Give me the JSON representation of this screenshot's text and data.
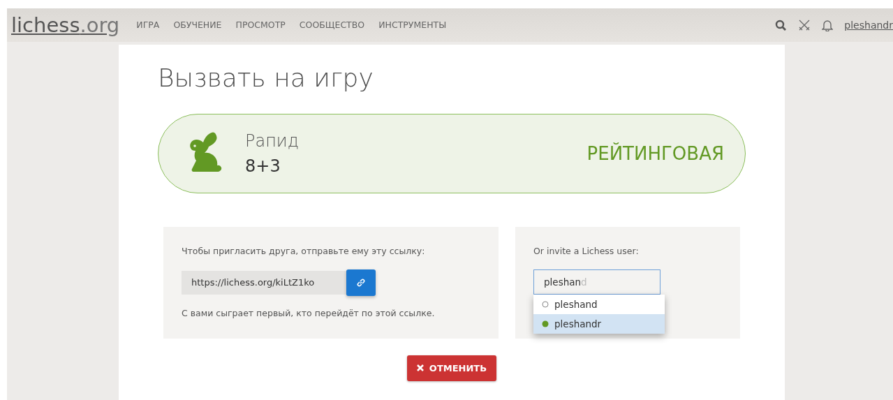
{
  "site": {
    "logo": "lichess",
    "logo_suffix": ".org",
    "nav": [
      "ИГРА",
      "ОБУЧЕНИЕ",
      "ПРОСМОТР",
      "СООБЩЕСТВО",
      "ИНСТРУМЕНТЫ"
    ],
    "username": "pleshandr"
  },
  "title": "Вызвать на игру",
  "game": {
    "variant": "Рапид",
    "clock": "8+3",
    "mode": "РЕЙТИНГОВАЯ"
  },
  "friend_link": {
    "intro": "Чтобы пригласить друга, отправьте ему эту ссылку:",
    "url": "https://lichess.org/kiLtZ1ko",
    "note": "С вами сыграет первый, кто перейдёт по этой ссылке."
  },
  "invite_user": {
    "label": "Or invite a Lichess user:",
    "value": "pleshan",
    "completion": "d",
    "suggestions": [
      {
        "name": "pleshand",
        "online": false,
        "selected": false
      },
      {
        "name": "pleshandr",
        "online": true,
        "selected": true
      }
    ]
  },
  "cancel_button": "ОТМЕНИТЬ"
}
